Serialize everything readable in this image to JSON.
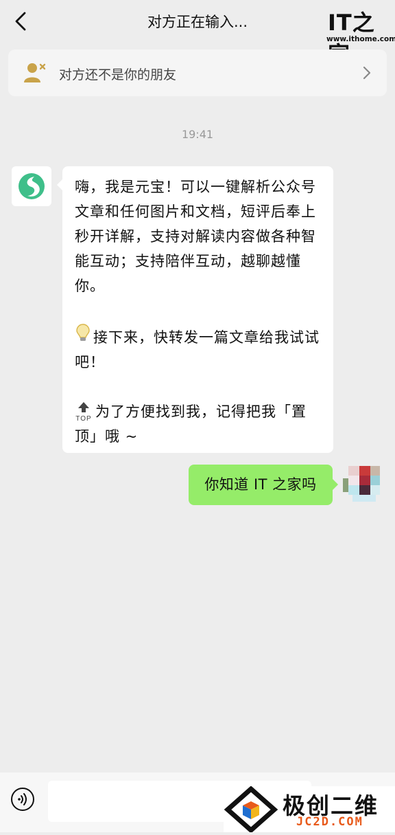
{
  "header": {
    "title": "对方正在输入...",
    "watermark_logo": "IT之家",
    "watermark_url": "www.ithome.com"
  },
  "notice": {
    "text": "对方还不是你的朋友"
  },
  "chat": {
    "timestamp": "19:41",
    "bot_message": {
      "para1": "嗨，我是元宝！可以一键解析公众号文章和任何图片和文档，短评后奉上秒开详解，支持对解读内容做各种智能互动；支持陪伴互动，越聊越懂你。",
      "para2": "接下来，快转发一篇文章给我试试吧！",
      "para3": "为了方便找到我，记得把我「置顶」哦 ~",
      "icons": [
        "lightbulb-icon",
        "top-arrow-icon"
      ]
    },
    "user_message": {
      "text": "你知道 IT 之家吗"
    }
  },
  "input_bar": {
    "value": ""
  },
  "watermark2": {
    "text": "极创二维",
    "url": "JC2D.COM"
  },
  "colors": {
    "background": "#ededed",
    "user_bubble": "#95ec69",
    "bot_bubble": "#ffffff",
    "bot_logo": "#3fbf8a"
  }
}
